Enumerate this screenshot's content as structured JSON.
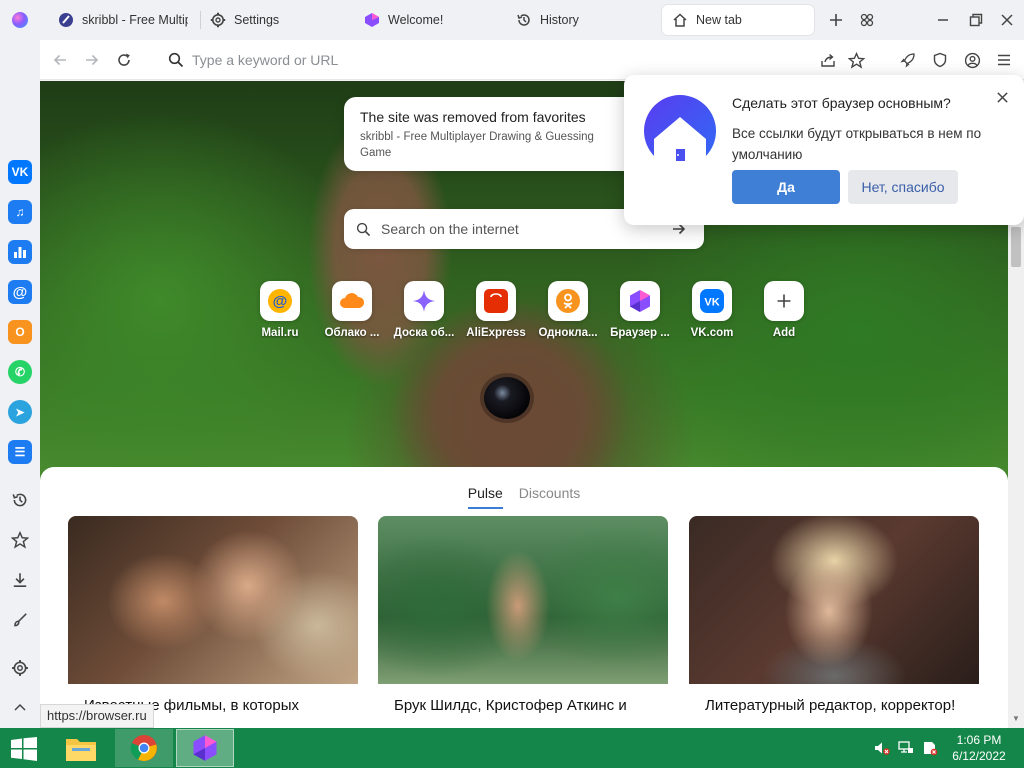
{
  "tabs": [
    {
      "label": "skribbl - Free Multipl",
      "icon": "skribbl-icon",
      "active": false
    },
    {
      "label": "Settings",
      "icon": "gear-icon",
      "active": false
    },
    {
      "label": "Welcome!",
      "icon": "atom-logo-icon",
      "active": false
    },
    {
      "label": "History",
      "icon": "history-icon",
      "active": false
    },
    {
      "label": "New tab",
      "icon": "home-icon",
      "active": true
    }
  ],
  "toolbar": {
    "omnibox_placeholder": "Type a keyword or URL"
  },
  "sidebar": {
    "apps": [
      {
        "name": "vk",
        "color": "#0077ff",
        "glyph": "VK"
      },
      {
        "name": "music",
        "color": "#1d7cf2",
        "glyph": "♫"
      },
      {
        "name": "stats",
        "color": "#1d7cf2",
        "glyph": "▮"
      },
      {
        "name": "mail",
        "color": "#1d7cf2",
        "glyph": "@"
      },
      {
        "name": "ok",
        "color": "#f7931e",
        "glyph": "О"
      },
      {
        "name": "whatsapp",
        "color": "#25d366",
        "glyph": "✆"
      },
      {
        "name": "telegram",
        "color": "#2aa3de",
        "glyph": "➤"
      },
      {
        "name": "tasks",
        "color": "#1d7cf2",
        "glyph": "☰"
      }
    ]
  },
  "toast": {
    "title": "The site was removed from favorites",
    "subtitle": "skribbl - Free Multiplayer Drawing & Guessing Game"
  },
  "hero_search": {
    "placeholder": "Search on the internet"
  },
  "speed_dial": [
    {
      "label": "Mail.ru",
      "color": "#ff9e00"
    },
    {
      "label": "Облако ...",
      "color": "#ff7a1a"
    },
    {
      "label": "Доска об...",
      "color": "#7b61ff"
    },
    {
      "label": "AliExpress",
      "color": "#e62e04"
    },
    {
      "label": "Однокла...",
      "color": "#f7931e"
    },
    {
      "label": "Браузер ...",
      "color": "#8a4dff"
    },
    {
      "label": "VK.com",
      "color": "#0077ff"
    },
    {
      "label": "Add",
      "color": "#444444"
    }
  ],
  "feed": {
    "tabs": [
      {
        "label": "Pulse",
        "active": true
      },
      {
        "label": "Discounts",
        "active": false
      }
    ],
    "cards": [
      {
        "title": "Известные фильмы, в которых настоящему"
      },
      {
        "title": "Брук Шилдс, Кристофер Аткинс и другие актеры знаменитого"
      },
      {
        "title": "Литературный редактор, корректор!"
      }
    ]
  },
  "status_url": "https://browser.ru",
  "popup": {
    "title": "Сделать этот браузер основным?",
    "body": "Все ссылки будут открываться в нем по умолчанию",
    "yes_label": "Да",
    "no_label": "Нет, спасибо"
  },
  "taskbar": {
    "time": "1:06 PM",
    "date": "6/12/2022"
  },
  "colors": {
    "accent": "#3f7fd6",
    "taskbar": "#15864a"
  }
}
